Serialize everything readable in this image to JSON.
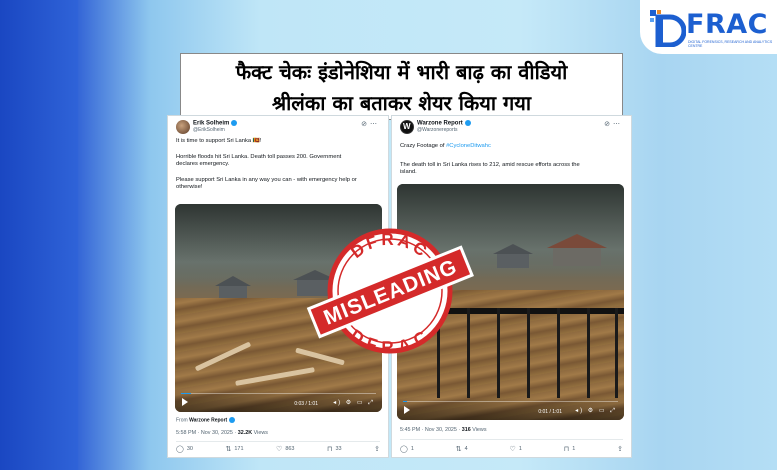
{
  "logo": {
    "text": "FRAC",
    "subtitle": "DIGITAL FORENSICS, RESEARCH AND ANALYTICS CENTRE"
  },
  "title": {
    "line1": "फैक्ट चेकः इंडोनेशिया में भारी बाढ़ का वीडियो",
    "line2": "श्रीलंका का बताकर शेयर किया गया"
  },
  "tweets": [
    {
      "name": "Erik Solheim",
      "handle": "@ErikSolheim",
      "lines": [
        "It is time to support Sri Lanka 🇱🇰!",
        "Horrible floods hit Sri Lanka. Death toll passes 200. Government",
        "declares emergency.",
        "Please support Sri Lanka in any way you can - with emergency help or",
        "otherwise!"
      ],
      "video_time": "0:03 / 1:01",
      "video_progress": 0.05,
      "from_label": "From",
      "from_account": "Warzone Report",
      "timestamp": "5:58 PM · Nov 30, 2025 · ",
      "views": "32.2K",
      "views_label": " Views",
      "actions": {
        "replies": "30",
        "reposts": "171",
        "likes": "863",
        "bookmarks": "33"
      }
    },
    {
      "name": "Warzone Report",
      "handle": "@Warzonereports",
      "crazy": "Crazy Footage of ",
      "hashtag": "#CycloneDitwahc",
      "lines": [
        "The death toll in Sri Lanka rises to 212, amid rescue efforts across the",
        "island."
      ],
      "video_time": "0:01 / 1:01",
      "video_progress": 0.02,
      "timestamp": "5:45 PM · Nov 30, 2025 · ",
      "views": "316",
      "views_label": " Views",
      "actions": {
        "replies": "1",
        "reposts": "4",
        "likes": "1",
        "bookmarks": "1"
      }
    }
  ],
  "stamp": {
    "top": "DFRAC",
    "label": "MISLEADING",
    "bottom": "DFRAC",
    "color": "#d42a2a"
  },
  "colors": {
    "accent": "#1d9bf0",
    "brand": "#1c5fd0"
  },
  "icons": [
    "reply-icon",
    "repost-icon",
    "like-icon",
    "bookmark-icon",
    "share-icon",
    "grok-icon",
    "more-icon",
    "play-icon",
    "volume-icon",
    "settings-icon",
    "expand-icon"
  ]
}
